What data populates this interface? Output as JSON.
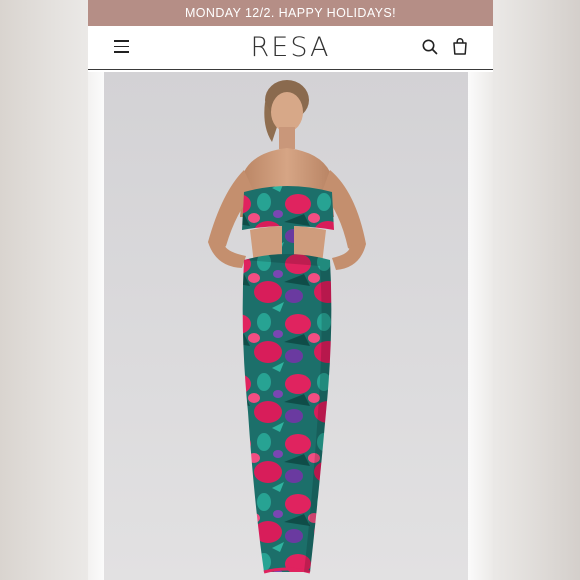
{
  "announcement": {
    "text": "MONDAY 12/2. HAPPY HOLIDAYS!"
  },
  "header": {
    "logo": "RESA",
    "menu_icon": "hamburger-menu-icon",
    "search_icon": "search-icon",
    "cart_icon": "shopping-bag-icon"
  },
  "product": {
    "image": "model wearing floral strapless maxi dress"
  },
  "colors": {
    "announcement_bg": "#b58e86",
    "dress_pink": "#e0235f",
    "dress_teal": "#1f8f86",
    "dress_purple": "#6a3aa0"
  }
}
